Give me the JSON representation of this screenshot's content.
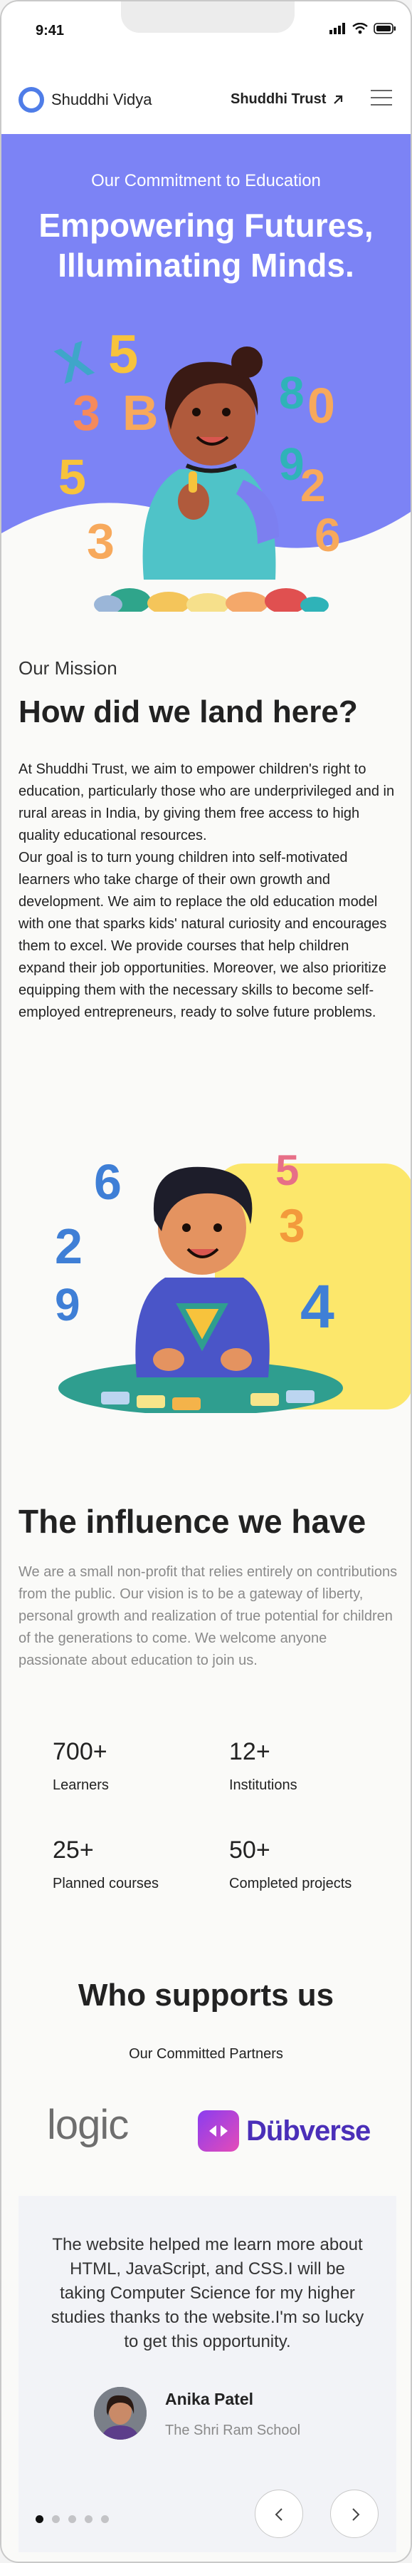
{
  "status_bar": {
    "time": "9:41"
  },
  "header": {
    "brand": "Shuddhi Vidya",
    "trust_link": "Shuddhi Trust"
  },
  "hero": {
    "subtitle": "Our Commitment to Education",
    "title_line1": "Empowering Futures,",
    "title_line2": "Illuminating Minds."
  },
  "mission": {
    "kicker": "Our Mission",
    "title": "How did we land here?",
    "paragraph1": "At Shuddhi Trust, we aim to empower children's right to education, particularly those who are underprivileged and in rural areas in India, by giving them free access to high quality educational resources.",
    "paragraph2": "Our goal is to turn young children into self-motivated learners who take charge of their own growth and development. We aim to replace the old education model with one that sparks kids' natural curiosity and encourages them to excel. We provide courses that help children expand their job opportunities. Moreover, we also prioritize equipping them with the necessary skills to become self-employed entrepreneurs, ready to solve future problems."
  },
  "influence": {
    "title": "The influence we have",
    "body": "We are a small non-profit that relies entirely on contributions from the public. Our vision is to be a gateway of liberty, personal growth and realization of true potential for children of the generations to come. We welcome anyone passionate about education to join us.",
    "stats": [
      {
        "value": "700+",
        "label": "Learners"
      },
      {
        "value": "12+",
        "label": "Institutions"
      },
      {
        "value": "25+",
        "label": "Planned courses"
      },
      {
        "value": "50+",
        "label": "Completed projects"
      }
    ]
  },
  "supporters": {
    "title": "Who supports us",
    "subtitle": "Our Committed Partners",
    "partners": [
      "logic",
      "Dübverse"
    ]
  },
  "testimonial": {
    "quote": "The website helped me learn more about HTML, JavaScript, and CSS.I will be taking Computer Science for my higher studies thanks to the website.I'm so lucky to get this opportunity.",
    "name": "Anika Patel",
    "school": "The Shri Ram School",
    "slide_count": 5,
    "active_slide": 1
  },
  "icons": {
    "signal": "signal-icon",
    "wifi": "wifi-icon",
    "battery": "battery-icon",
    "arrow": "arrow-up-right-icon",
    "menu": "hamburger-menu-icon",
    "prev": "chevron-left-icon",
    "next": "chevron-right-icon"
  },
  "colors": {
    "hero_bg": "#7c83f5",
    "brand_blue": "#4f7de8",
    "kid_bg_yellow": "#fce76b",
    "dubverse_purple": "#4a2fb8"
  }
}
